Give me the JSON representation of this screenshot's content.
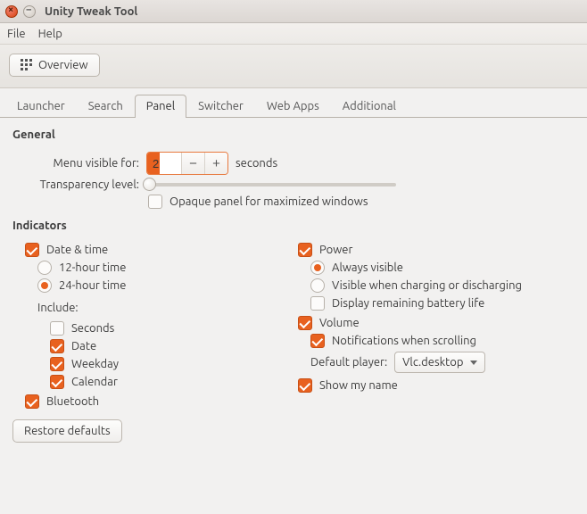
{
  "window": {
    "title": "Unity Tweak Tool"
  },
  "menubar": {
    "file": "File",
    "help": "Help"
  },
  "toolbar": {
    "overview": "Overview"
  },
  "tabs": {
    "launcher": "Launcher",
    "search": "Search",
    "panel": "Panel",
    "switcher": "Switcher",
    "webapps": "Web Apps",
    "additional": "Additional"
  },
  "general": {
    "header": "General",
    "menu_visible_label": "Menu visible for:",
    "menu_visible_value": "2",
    "seconds": "seconds",
    "transparency_label": "Transparency level:",
    "opaque_panel": "Opaque panel for maximized windows"
  },
  "indicators": {
    "header": "Indicators",
    "datetime": {
      "label": "Date & time",
      "h12": "12-hour time",
      "h24": "24-hour time",
      "include_label": "Include:",
      "seconds": "Seconds",
      "date": "Date",
      "weekday": "Weekday",
      "calendar": "Calendar"
    },
    "bluetooth": "Bluetooth",
    "power": {
      "label": "Power",
      "always": "Always visible",
      "charging": "Visible when charging or discharging",
      "remaining": "Display remaining battery life"
    },
    "volume": {
      "label": "Volume",
      "notifications": "Notifications when scrolling",
      "default_player_label": "Default player:",
      "default_player_value": "Vlc.desktop"
    },
    "show_name": "Show my name"
  },
  "footer": {
    "restore": "Restore defaults"
  }
}
